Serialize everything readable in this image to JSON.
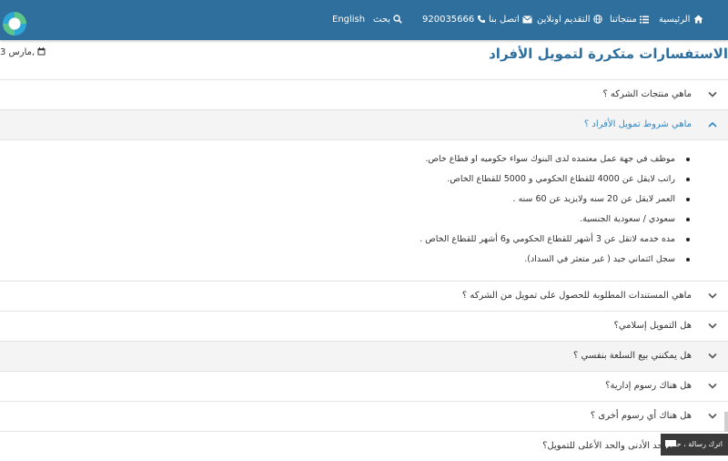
{
  "nav": {
    "home": "الرئيسية",
    "products": "منتجاتنا",
    "apply_online": "التقديم اونلاين",
    "contact": "اتصل بنا",
    "phone": "920035666",
    "search": "بحث",
    "language": "English"
  },
  "page": {
    "title": "الاستفسارات متكررة لتمويل الأفراد",
    "date": "مارس 3,"
  },
  "faq": {
    "items": [
      {
        "question": "ماهي منتجات الشركه ؟"
      },
      {
        "question": "ماهي شروط تمويل الأفراد ؟"
      },
      {
        "question": "ماهي المستندات المطلوبة للحصول على تمويل من الشركه ؟"
      },
      {
        "question": "هل التمويل إسلامي؟"
      },
      {
        "question": "هل يمكنني بيع السلعة بنفسي ؟"
      },
      {
        "question": "هل هناك رسوم إدارية؟"
      },
      {
        "question": "هل هناك أي رسوم أخرى ؟"
      },
      {
        "question": "ما هو الحد الأدنى والحد الأعلى للتمويل؟"
      }
    ],
    "answer": [
      "موظف في جهة عمل معتمده لدى البنوك سواء حكوميه او قطاع خاص.",
      "راتب لايقل عن 4000 للقطاع الحكومي و 5000 للقطاع الخاص.",
      "العمر لايقل عن 20 سنه ولايزيد عن 60 سنه .",
      "سعودي / سعودية الجنسية.",
      "مده خدمه لاتقل عن 3 أشهر للقطاع الحكومي و6 أشهر للقطاع الخاص .",
      "سجل ائتماني جيد ( غير متعثر في السداد)."
    ]
  },
  "chat": {
    "label": "اترك رسالة ، حاليا"
  },
  "colors": {
    "nav_bg": "#2e6f9e",
    "title": "#2e6f9e",
    "active_question": "#2e87c7"
  }
}
